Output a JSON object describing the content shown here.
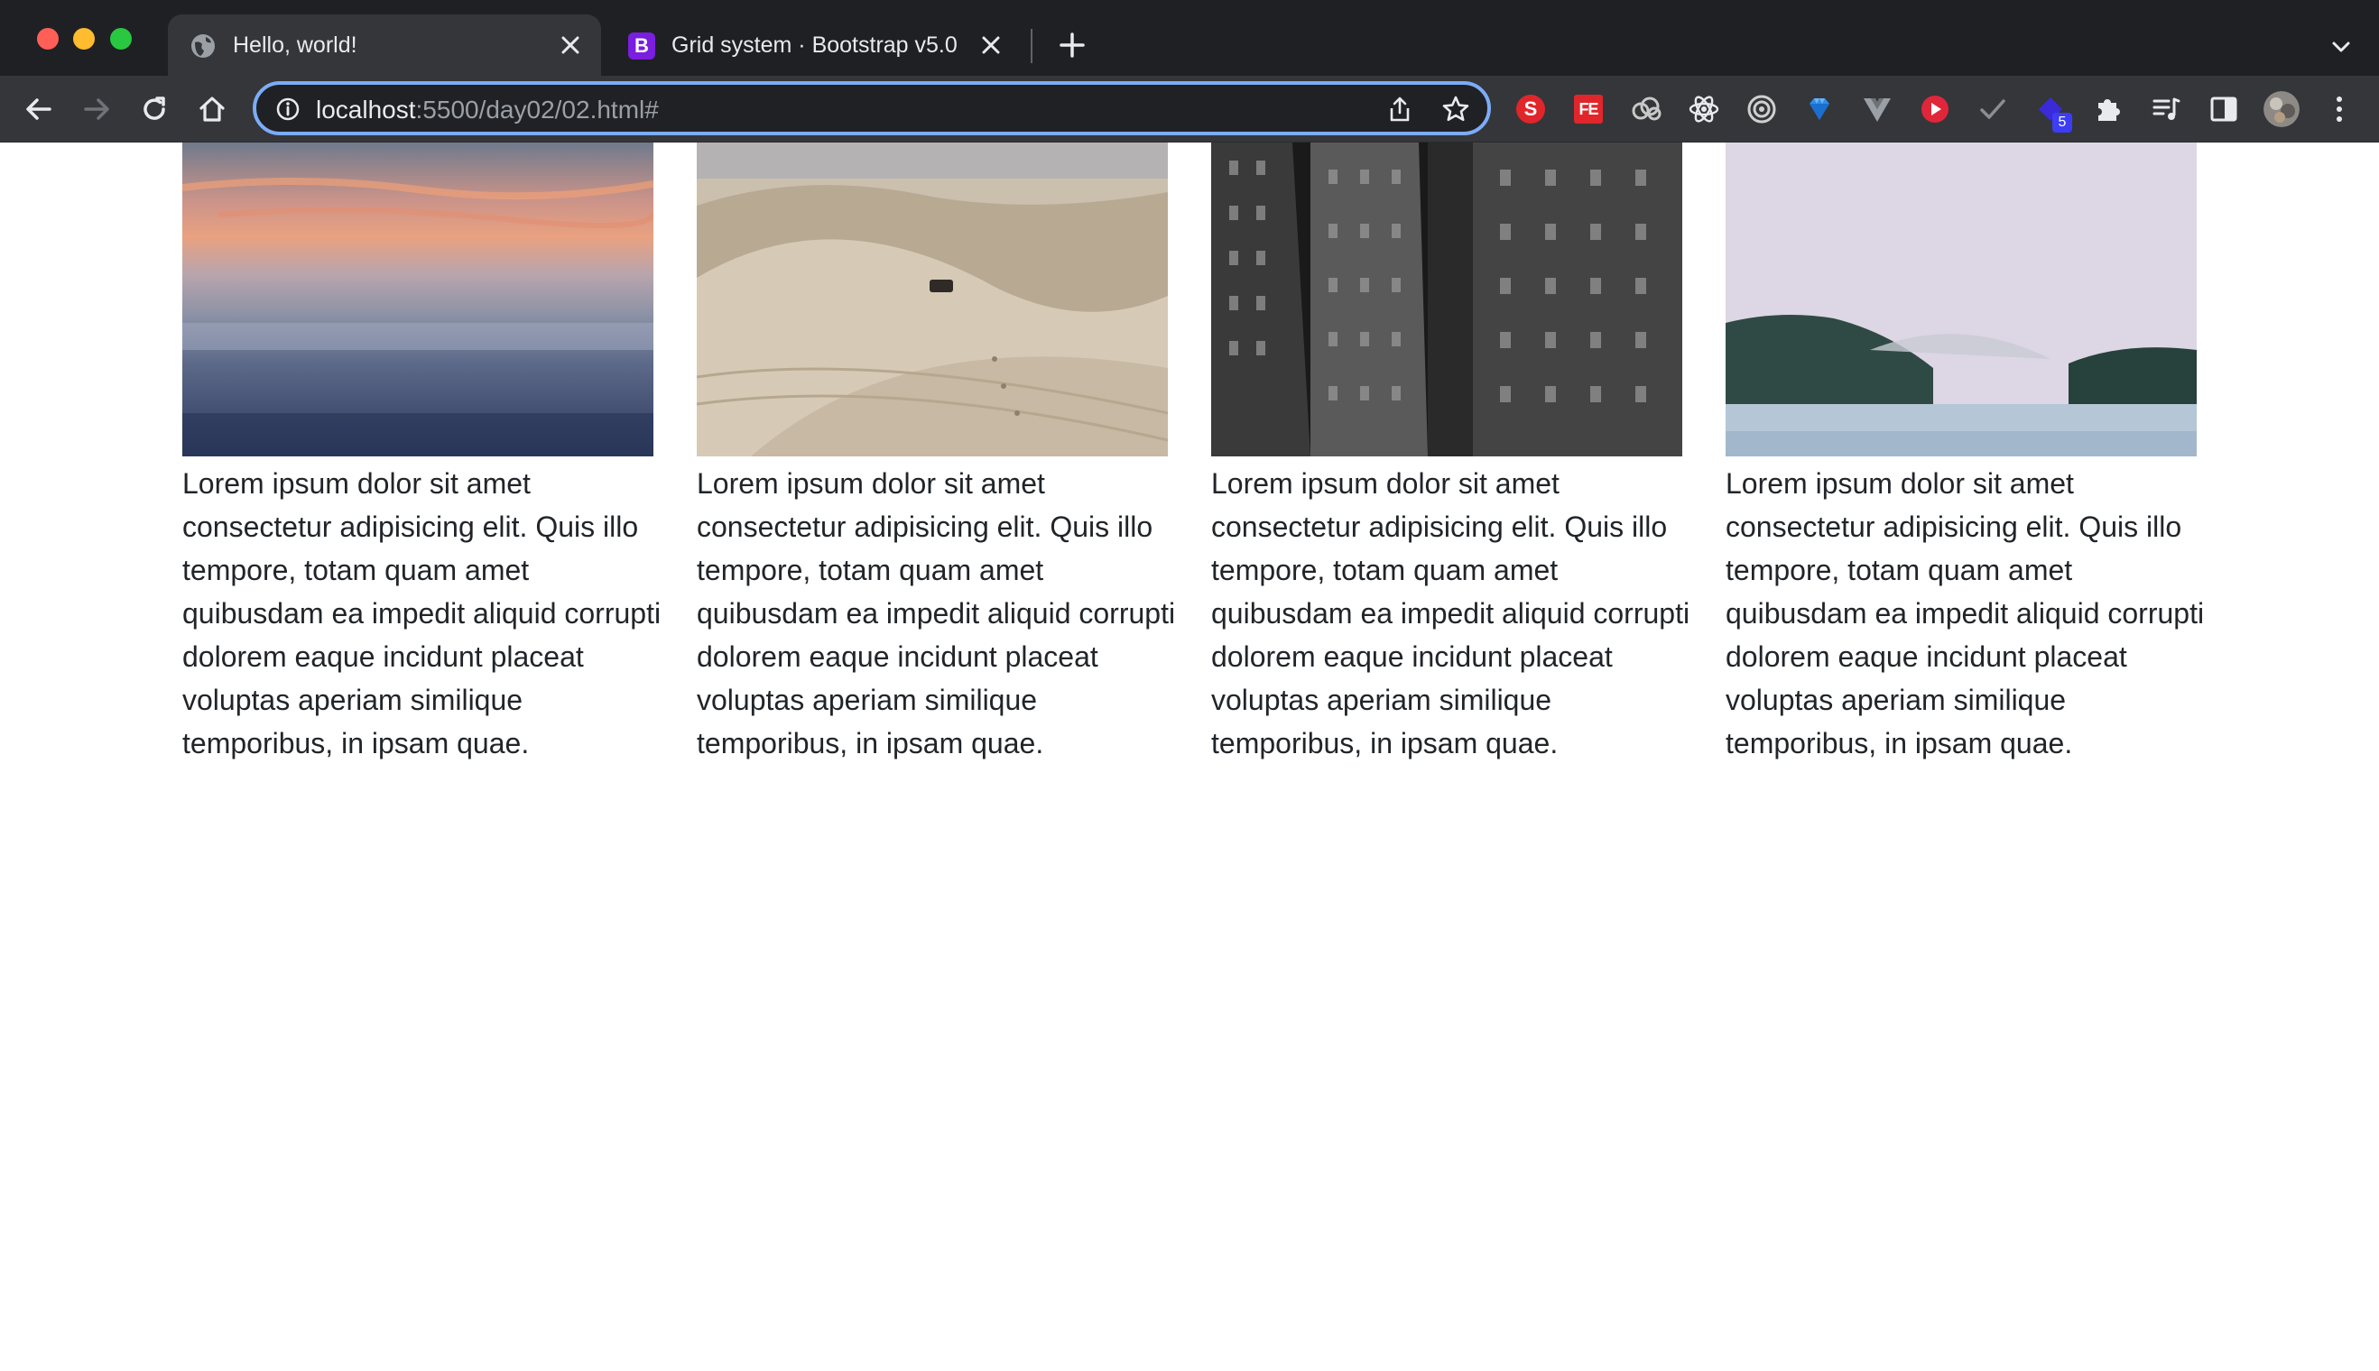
{
  "browser": {
    "tabs": [
      {
        "title": "Hello, world!",
        "favicon": "globe-icon",
        "active": true
      },
      {
        "title": "Grid system · Bootstrap v5.0",
        "favicon": "bootstrap-icon",
        "active": false
      }
    ],
    "bootstrap_favicon_letter": "B",
    "address": {
      "host": "localhost",
      "rest": ":5500/day02/02.html#"
    },
    "extensions": [
      "s-extension-icon",
      "fe-extension-icon",
      "clouds-extension-icon",
      "react-devtools-icon",
      "target-extension-icon",
      "gem-extension-icon",
      "vue-devtools-icon",
      "play-extension-icon",
      "check-extension-icon",
      "diamond-extension-icon",
      "puzzle-icon",
      "reading-list-icon",
      "side-panel-icon",
      "profile-avatar"
    ],
    "s_extension_letter": "S",
    "fe_extension_letters": "FE",
    "extension_badge_count": "5"
  },
  "columns": [
    {
      "image": "sunset-sea-photo",
      "text": "Lorem ipsum dolor sit amet consectetur adipisicing elit. Quis illo tempore, totam quam amet quibusdam ea impedit aliquid corrupti dolorem eaque incidunt placeat voluptas aperiam similique temporibus, in ipsam quae."
    },
    {
      "image": "desert-dunes-photo",
      "text": "Lorem ipsum dolor sit amet consectetur adipisicing elit. Quis illo tempore, totam quam amet quibusdam ea impedit aliquid corrupti dolorem eaque incidunt placeat voluptas aperiam similique temporibus, in ipsam quae."
    },
    {
      "image": "building-photo",
      "text": "Lorem ipsum dolor sit amet consectetur adipisicing elit. Quis illo tempore, totam quam amet quibusdam ea impedit aliquid corrupti dolorem eaque incidunt placeat voluptas aperiam similique temporibus, in ipsam quae."
    },
    {
      "image": "misty-forest-lake-photo",
      "text": "Lorem ipsum dolor sit amet consectetur adipisicing elit. Quis illo tempore, totam quam amet quibusdam ea impedit aliquid corrupti dolorem eaque incidunt placeat voluptas aperiam similique temporibus, in ipsam quae."
    }
  ],
  "colors": {
    "accent_focus": "#7cacf8",
    "chrome_dark": "#1f2023",
    "toolbar": "#35363a",
    "text": "#212529"
  }
}
